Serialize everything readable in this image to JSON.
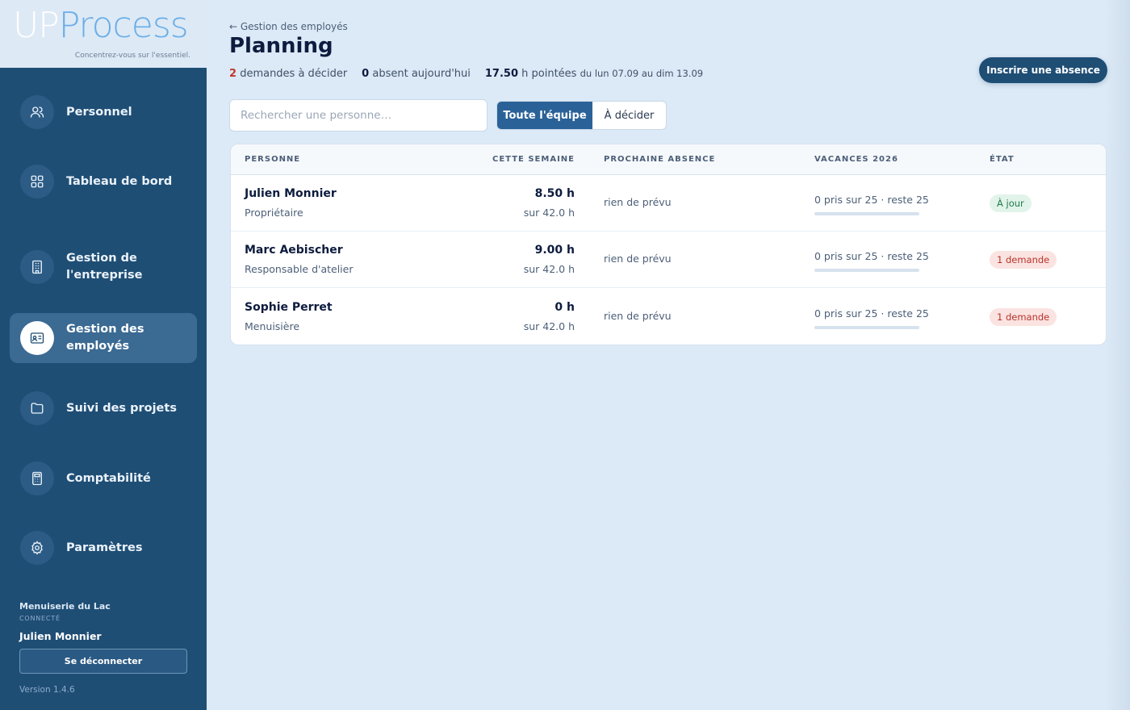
{
  "brand": {
    "logo_up": "UP",
    "logo_process": "Process",
    "tagline": "Concentrez-vous sur l'essentiel."
  },
  "sidebar": {
    "items": [
      {
        "label": "Personnel",
        "icon": "users-icon"
      },
      {
        "label": "Tableau de bord",
        "icon": "dashboard-grid-icon"
      },
      {
        "label": "Gestion de l'entreprise",
        "icon": "building-icon"
      },
      {
        "label": "Gestion des employés",
        "icon": "id-card-icon",
        "active": true
      },
      {
        "label": "Suivi des projets",
        "icon": "folder-icon"
      },
      {
        "label": "Comptabilité",
        "icon": "calculator-icon"
      },
      {
        "label": "Paramètres",
        "icon": "gear-icon"
      }
    ],
    "company": "Menuiserie du Lac",
    "connected_label": "CONNECTÉ",
    "user": "Julien Monnier",
    "logout_label": "Se déconnecter",
    "version": "Version 1.4.6"
  },
  "header": {
    "breadcrumb": "← Gestion des employés",
    "title": "Planning",
    "stats": {
      "requests_count": "2",
      "requests_label": "demandes à décider",
      "absent_count": "0",
      "absent_label": "absent aujourd'hui",
      "hours_value": "17.50",
      "hours_label": "h pointées",
      "period": "du lun 07.09 au dim 13.09"
    },
    "cta_label": "Inscrire une absence"
  },
  "filters": {
    "search_placeholder": "Rechercher une personne…",
    "tabs": [
      {
        "label": "Toute l'équipe",
        "active": true
      },
      {
        "label": "À décider",
        "active": false
      }
    ]
  },
  "table": {
    "headers": [
      "PERSONNE",
      "CETTE SEMAINE",
      "PROCHAINE ABSENCE",
      "VACANCES 2026",
      "ÉTAT"
    ],
    "rows": [
      {
        "name": "Julien Monnier",
        "role": "Propriétaire",
        "hours": "8.50 h",
        "hours_of": "sur 42.0 h",
        "next_absence": "rien de prévu",
        "vacation": "0 pris sur 25 · reste 25",
        "vacation_used_fraction": 0,
        "status": "À jour",
        "status_type": "ok"
      },
      {
        "name": "Marc Aebischer",
        "role": "Responsable d'atelier",
        "hours": "9.00 h",
        "hours_of": "sur 42.0 h",
        "next_absence": "rien de prévu",
        "vacation": "0 pris sur 25 · reste 25",
        "vacation_used_fraction": 0,
        "status": "1 demande",
        "status_type": "pending"
      },
      {
        "name": "Sophie Perret",
        "role": "Menuisière",
        "hours": "0 h",
        "hours_of": "sur 42.0 h",
        "next_absence": "rien de prévu",
        "vacation": "0 pris sur 25 · reste 25",
        "vacation_used_fraction": 0,
        "status": "1 demande",
        "status_type": "pending"
      }
    ]
  },
  "colors": {
    "sidebar_bg": "#1f4e75",
    "page_bg": "#dce9f6",
    "accent": "#2a6298",
    "ok_badge": "#1e7a4a",
    "pending_badge": "#b8342a",
    "red_count": "#c0392b"
  }
}
